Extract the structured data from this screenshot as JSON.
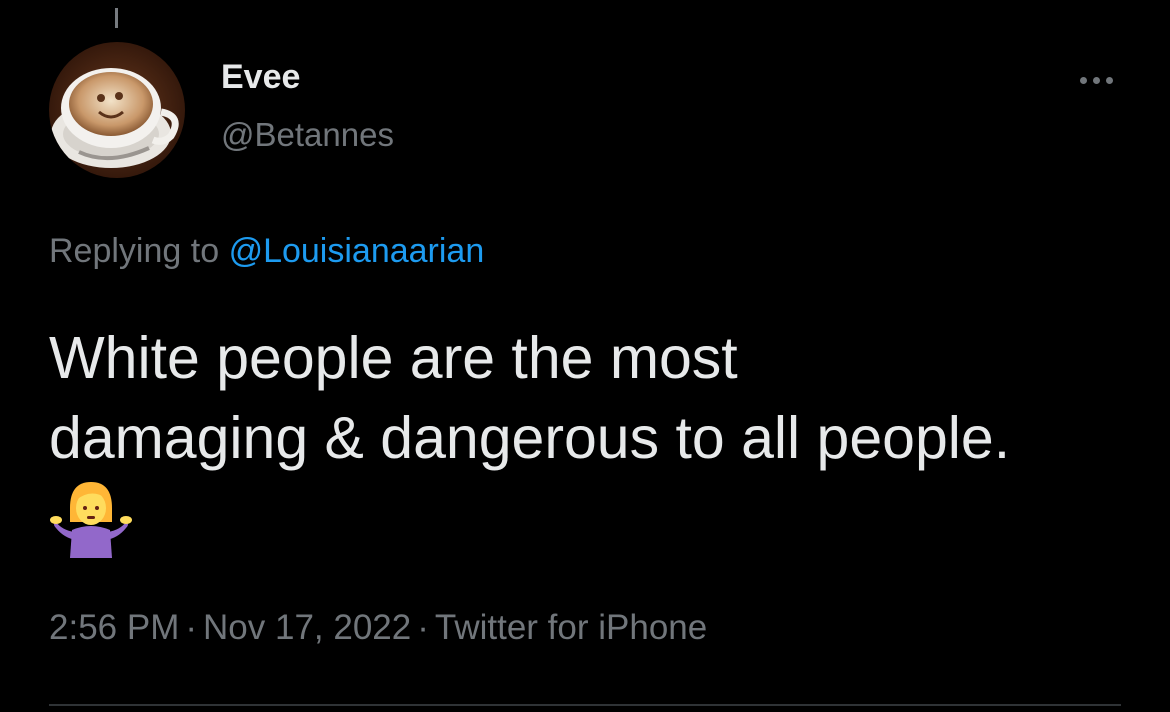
{
  "tweet": {
    "author": {
      "display_name": "Evee",
      "handle": "@Betannes",
      "avatar": "coffee-cup-latte-art-avatar"
    },
    "more_icon": "more-horizontal-icon",
    "replying_to": {
      "prefix": "Replying to",
      "mention": "@Louisianaarian"
    },
    "text_lines": [
      "White people are the most",
      "damaging & dangerous to all people."
    ],
    "emoji": "woman-shrugging-emoji",
    "meta": {
      "time": "2:56 PM",
      "date": "Nov 17, 2022",
      "source": "Twitter for iPhone",
      "separator": "·"
    }
  },
  "colors": {
    "background": "#000000",
    "primary_text": "#e7e9ea",
    "secondary_text": "#71767b",
    "link": "#1d9bf0",
    "divider": "#2f3336"
  }
}
